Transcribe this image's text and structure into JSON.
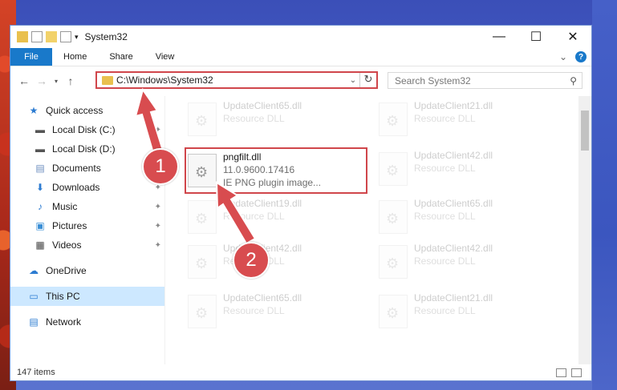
{
  "window": {
    "title": "System32",
    "minimize_glyph": "—",
    "maximize_glyph": "☐",
    "close_glyph": "✕"
  },
  "ribbon": {
    "tabs": [
      "File",
      "Home",
      "Share",
      "View"
    ],
    "help_glyph": "?"
  },
  "address": {
    "path": "C:\\Windows\\System32"
  },
  "search": {
    "placeholder": "Search System32"
  },
  "sidebar": {
    "items": [
      {
        "label": "Quick access",
        "icon": "star-icon"
      },
      {
        "label": "Local Disk (C:)",
        "icon": "disk-icon"
      },
      {
        "label": "Local Disk (D:)",
        "icon": "disk-icon"
      },
      {
        "label": "Documents",
        "icon": "documents-icon"
      },
      {
        "label": "Downloads",
        "icon": "download-icon"
      },
      {
        "label": "Music",
        "icon": "music-icon"
      },
      {
        "label": "Pictures",
        "icon": "pictures-icon"
      },
      {
        "label": "Videos",
        "icon": "videos-icon"
      },
      {
        "label": "OneDrive",
        "icon": "cloud-icon"
      },
      {
        "label": "This PC",
        "icon": "computer-icon"
      },
      {
        "label": "Network",
        "icon": "network-icon"
      }
    ]
  },
  "files": [
    {
      "name": "UpdateClient65.dll",
      "sub": "Resource DLL"
    },
    {
      "name": "UpdateClient21.dll",
      "sub": "Resource DLL"
    },
    {
      "name": "pngfilt.dll",
      "sub": "11.0.9600.17416",
      "sub2": "IE PNG plugin image..."
    },
    {
      "name": "UpdateClient42.dll",
      "sub": "Resource DLL"
    },
    {
      "name": "UpdateClient19.dll",
      "sub": "Resource DLL"
    },
    {
      "name": "UpdateClient65.dll",
      "sub": "Resource DLL"
    },
    {
      "name": "UpdateClient42.dll",
      "sub": "Resource DLL"
    },
    {
      "name": "UpdateClient42.dll",
      "sub": "Resource DLL"
    },
    {
      "name": "UpdateClient65.dll",
      "sub": "Resource DLL"
    },
    {
      "name": "UpdateClient21.dll",
      "sub": "Resource DLL"
    }
  ],
  "status": {
    "count": "147 items"
  },
  "badges": {
    "one": "1",
    "two": "2"
  },
  "colors": {
    "accent": "#1979ca",
    "highlight": "#d0464b"
  }
}
